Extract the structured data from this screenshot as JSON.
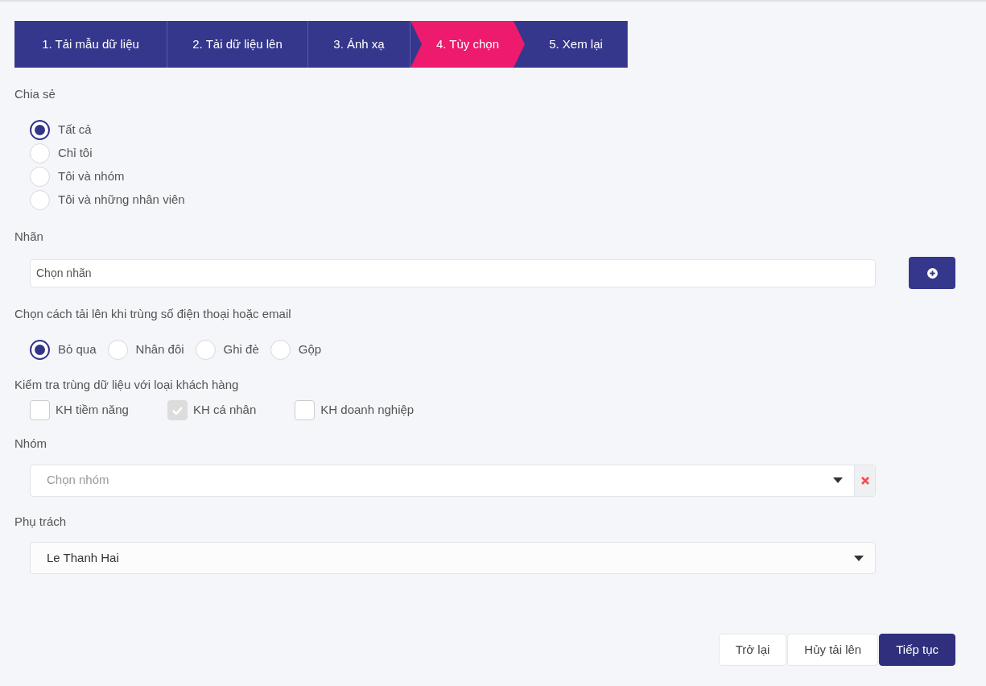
{
  "steps": [
    {
      "label": "1. Tải mẫu dữ liệu",
      "selected": false
    },
    {
      "label": "2. Tải dữ liệu lên",
      "selected": false
    },
    {
      "label": "3. Ánh xạ",
      "selected": false
    },
    {
      "label": "4. Tùy chọn",
      "selected": true
    },
    {
      "label": "5. Xem lại",
      "selected": false
    }
  ],
  "share": {
    "label": "Chia sẻ",
    "options": [
      {
        "label": "Tất cả",
        "selected": true
      },
      {
        "label": "Chỉ tôi",
        "selected": false
      },
      {
        "label": "Tôi và nhóm",
        "selected": false
      },
      {
        "label": "Tôi và những nhân viên",
        "selected": false
      }
    ]
  },
  "tags": {
    "label": "Nhãn",
    "placeholder": "Chọn nhãn"
  },
  "duplicate_mode": {
    "label": "Chọn cách tải lên khi trùng số điện thoại hoặc email",
    "options": [
      {
        "label": "Bỏ qua",
        "selected": true
      },
      {
        "label": "Nhân đôi",
        "selected": false
      },
      {
        "label": "Ghi đè",
        "selected": false
      },
      {
        "label": "Gộp",
        "selected": false
      }
    ]
  },
  "duplicate_check": {
    "label": "Kiểm tra trùng dữ liệu với loại khách hàng",
    "options": [
      {
        "label": "KH tiềm năng",
        "checked": false
      },
      {
        "label": "KH cá nhân",
        "checked": true
      },
      {
        "label": "KH doanh nghiệp",
        "checked": false
      }
    ]
  },
  "group": {
    "label": "Nhóm",
    "placeholder": "Chọn nhóm"
  },
  "owner": {
    "label": "Phụ trách",
    "value": "Le Thanh Hai"
  },
  "buttons": [
    {
      "label": "Trở lại",
      "kind": "default"
    },
    {
      "label": "Hủy tải lên",
      "kind": "default"
    },
    {
      "label": "Tiếp tục",
      "kind": "primary"
    }
  ]
}
